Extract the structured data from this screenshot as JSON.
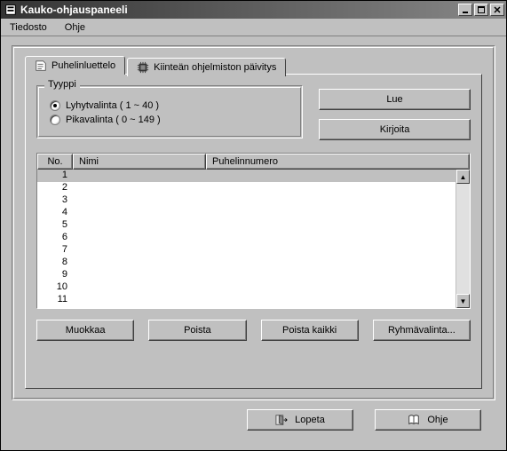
{
  "window": {
    "title": "Kauko-ohjauspaneeli"
  },
  "menu": {
    "file": "Tiedosto",
    "help": "Ohje"
  },
  "tabs": {
    "phonebook": "Puhelinluettelo",
    "firmware": "Kiinteän ohjelmiston päivitys"
  },
  "group": {
    "legend": "Tyyppi",
    "speed": "Lyhytvalinta ( 1 ~ 40 )",
    "quick": "Pikavalinta ( 0 ~ 149 )"
  },
  "buttons": {
    "read": "Lue",
    "write": "Kirjoita",
    "edit": "Muokkaa",
    "delete": "Poista",
    "deleteAll": "Poista kaikki",
    "groupDial": "Ryhmävalinta...",
    "quit": "Lopeta",
    "help": "Ohje"
  },
  "columns": {
    "no": "No.",
    "name": "Nimi",
    "phone": "Puhelinnumero"
  },
  "rows": [
    {
      "no": "1",
      "name": "",
      "phone": ""
    },
    {
      "no": "2",
      "name": "",
      "phone": ""
    },
    {
      "no": "3",
      "name": "",
      "phone": ""
    },
    {
      "no": "4",
      "name": "",
      "phone": ""
    },
    {
      "no": "5",
      "name": "",
      "phone": ""
    },
    {
      "no": "6",
      "name": "",
      "phone": ""
    },
    {
      "no": "7",
      "name": "",
      "phone": ""
    },
    {
      "no": "8",
      "name": "",
      "phone": ""
    },
    {
      "no": "9",
      "name": "",
      "phone": ""
    },
    {
      "no": "10",
      "name": "",
      "phone": ""
    },
    {
      "no": "11",
      "name": "",
      "phone": ""
    }
  ],
  "selectedRow": 0
}
